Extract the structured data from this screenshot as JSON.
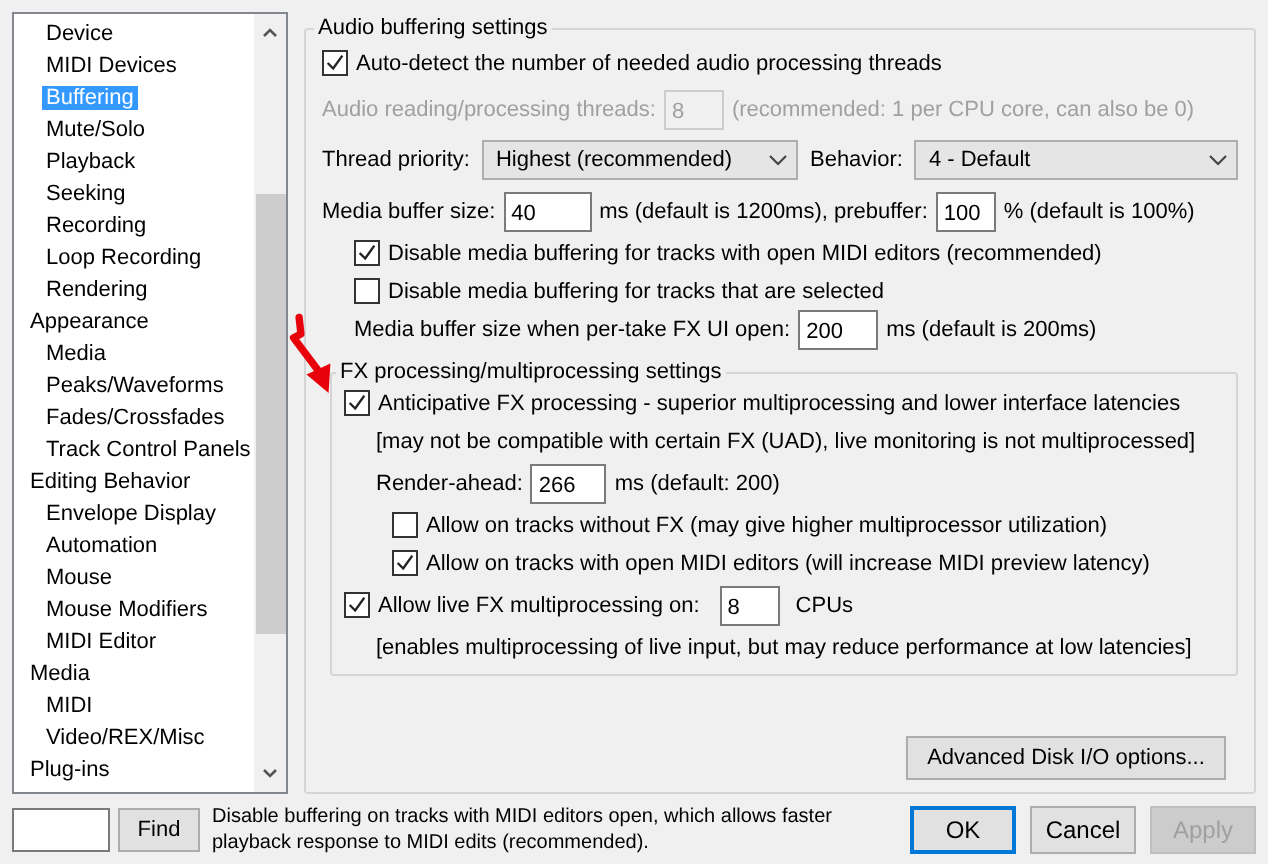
{
  "tree": {
    "items": [
      {
        "children": [
          {
            "label": "Device",
            "selected": false
          },
          {
            "label": "MIDI Devices",
            "selected": false
          },
          {
            "label": "Buffering",
            "selected": true
          },
          {
            "label": "Mute/Solo",
            "selected": false
          },
          {
            "label": "Playback",
            "selected": false
          },
          {
            "label": "Seeking",
            "selected": false
          },
          {
            "label": "Recording",
            "selected": false
          },
          {
            "label": "Loop Recording",
            "selected": false
          },
          {
            "label": "Rendering",
            "selected": false
          }
        ]
      },
      {
        "label": "Appearance",
        "selected": false,
        "children": [
          {
            "label": "Media",
            "selected": false
          },
          {
            "label": "Peaks/Waveforms",
            "selected": false
          },
          {
            "label": "Fades/Crossfades",
            "selected": false
          },
          {
            "label": "Track Control Panels",
            "selected": false
          }
        ]
      },
      {
        "label": "Editing Behavior",
        "selected": false,
        "children": [
          {
            "label": "Envelope Display",
            "selected": false
          },
          {
            "label": "Automation",
            "selected": false
          },
          {
            "label": "Mouse",
            "selected": false
          },
          {
            "label": "Mouse Modifiers",
            "selected": false
          },
          {
            "label": "MIDI Editor",
            "selected": false
          }
        ]
      },
      {
        "label": "Media",
        "selected": false,
        "children": [
          {
            "label": "MIDI",
            "selected": false
          },
          {
            "label": "Video/REX/Misc",
            "selected": false
          }
        ]
      },
      {
        "label": "Plug-ins",
        "selected": false
      }
    ]
  },
  "audio_group": {
    "title": "Audio buffering settings",
    "auto_detect": {
      "label": "Auto-detect the number of needed audio processing threads",
      "checked": true
    },
    "threads": {
      "label": "Audio reading/processing threads:",
      "value": "8",
      "note": "(recommended: 1 per CPU core, can also be 0)",
      "disabled": true
    },
    "thread_priority": {
      "label": "Thread priority:",
      "value": "Highest (recommended)"
    },
    "behavior": {
      "label": "Behavior:",
      "value": "4 - Default"
    },
    "buffer": {
      "label": "Media buffer size:",
      "value": "40",
      "note": "ms (default is 1200ms), prebuffer:"
    },
    "prebuffer": {
      "value": "100",
      "note": "% (default is 100%)"
    },
    "checks": [
      {
        "label": "Disable media buffering for tracks with open MIDI editors (recommended)",
        "checked": true
      },
      {
        "label": "Disable media buffering for tracks that are selected",
        "checked": false
      }
    ],
    "per_take": {
      "label": "Media buffer size when per-take FX UI open:",
      "value": "200",
      "note": "ms (default is 200ms)"
    }
  },
  "fx_group": {
    "title": "FX processing/multiprocessing settings",
    "anticipative": {
      "label": "Anticipative FX processing - superior multiprocessing and lower interface latencies",
      "checked": true
    },
    "warning": "[may not be compatible with certain FX (UAD), live monitoring is not multiprocessed]",
    "render_ahead": {
      "label": "Render-ahead:",
      "value": "266",
      "note": "ms (default: 200)"
    },
    "checks": [
      {
        "label": "Allow on tracks without FX (may give higher multiprocessor utilization)",
        "checked": false
      },
      {
        "label": "Allow on tracks with open MIDI editors (will increase MIDI preview latency)",
        "checked": true
      }
    ],
    "live": {
      "label": "Allow live FX multiprocessing on:",
      "checked": true,
      "value": "8",
      "unit": "CPUs"
    },
    "live_note": "[enables multiprocessing of live input, but may reduce performance at low latencies]"
  },
  "advanced_button": "Advanced Disk I/O options...",
  "find": {
    "button": "Find"
  },
  "hint": "Disable buffering on tracks with MIDI editors open, which allows faster playback response to MIDI edits (recommended).",
  "dialog_buttons": [
    {
      "label": "OK",
      "default": true,
      "disabled": false
    },
    {
      "label": "Cancel",
      "default": false,
      "disabled": false
    },
    {
      "label": "Apply",
      "default": false,
      "disabled": true
    }
  ]
}
